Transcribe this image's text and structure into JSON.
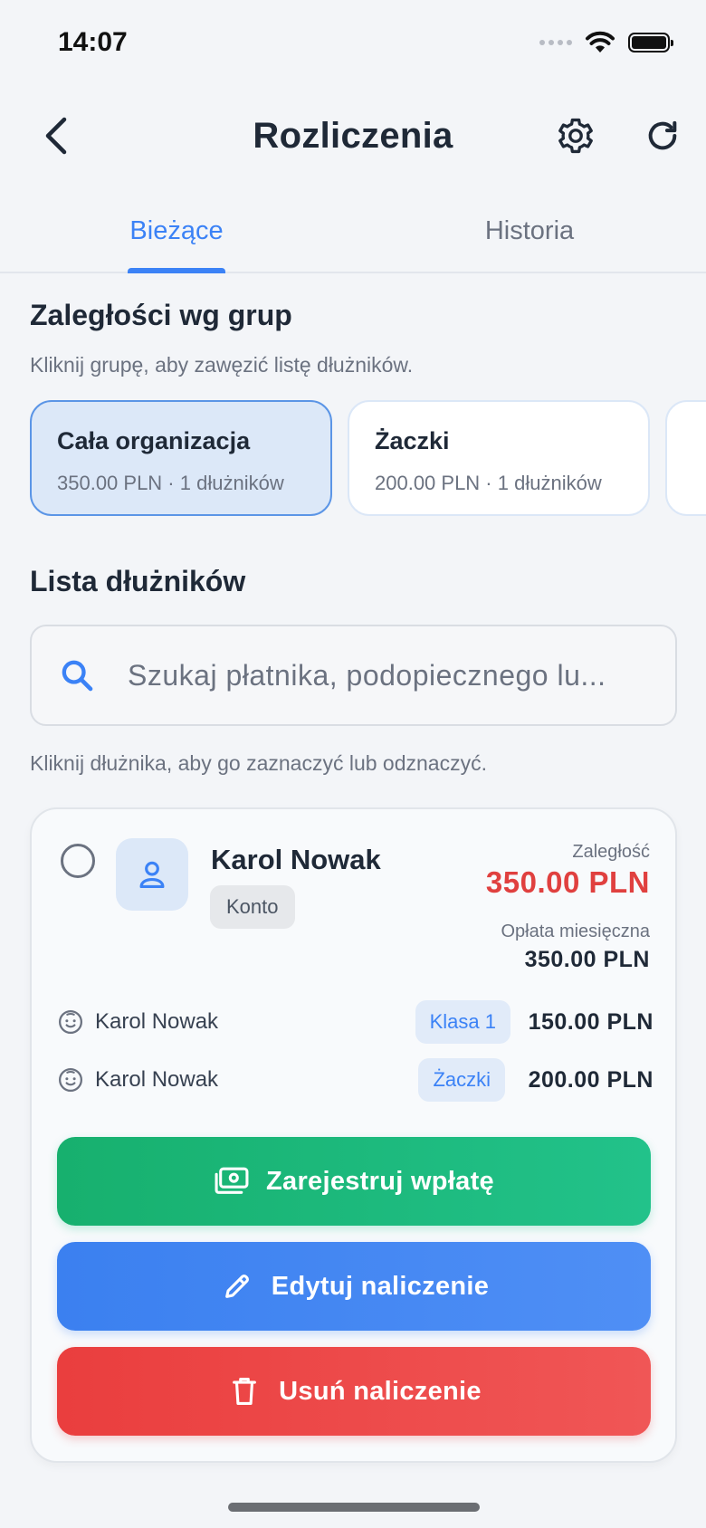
{
  "status_bar": {
    "time": "14:07"
  },
  "header": {
    "title": "Rozliczenia"
  },
  "tabs": [
    {
      "label": "Bieżące",
      "active": true
    },
    {
      "label": "Historia",
      "active": false
    }
  ],
  "groups_section": {
    "title": "Zaległości wg grup",
    "hint": "Kliknij grupę, aby zawęzić listę dłużników.",
    "groups": [
      {
        "name": "Cała organizacja",
        "meta": "350.00 PLN · 1 dłużników",
        "active": true
      },
      {
        "name": "Żaczki",
        "meta": "200.00 PLN · 1 dłużników",
        "active": false
      }
    ]
  },
  "debtors_section": {
    "title": "Lista dłużników",
    "search_placeholder": "Szukaj płatnika, podopiecznego lu...",
    "search_value": "",
    "hint": "Kliknij dłużnika, aby go zaznaczyć lub odznaczyć."
  },
  "debtor": {
    "name": "Karol Nowak",
    "badge": "Konto",
    "debt_label": "Zaległość",
    "debt_value": "350.00 PLN",
    "fee_label": "Opłata miesięczna",
    "fee_value": "350.00 PLN",
    "kids": [
      {
        "name": "Karol Nowak",
        "group": "Klasa 1",
        "amount": "150.00 PLN"
      },
      {
        "name": "Karol Nowak",
        "group": "Żaczki",
        "amount": "200.00 PLN"
      }
    ],
    "actions": {
      "register_payment": "Zarejestruj wpłatę",
      "edit_charge": "Edytuj naliczenie",
      "delete_charge": "Usuń naliczenie"
    }
  },
  "colors": {
    "accent": "#3b82f6",
    "debt": "#e0403f",
    "success": "#22c28a",
    "danger": "#ea3e3e"
  }
}
